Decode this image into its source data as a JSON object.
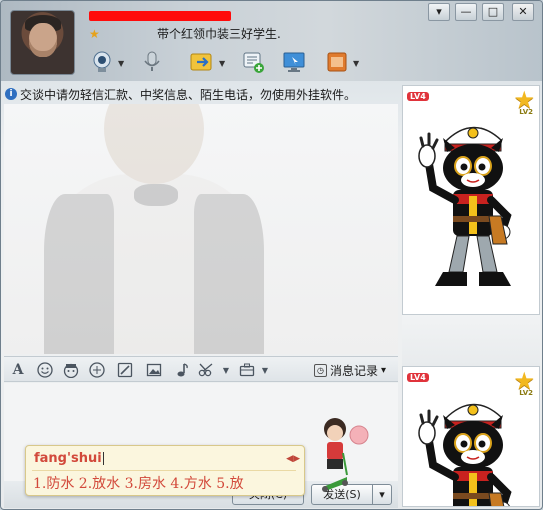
{
  "window": {
    "controls": {
      "menu": "▾",
      "minimize": "—",
      "maximize": "□",
      "close": "✕"
    }
  },
  "contact": {
    "signature": "带个红领巾装三好学生."
  },
  "notice": {
    "text": "交谈中请勿轻信汇款、中奖信息、陌生电话，勿使用外挂软件。"
  },
  "format_bar": {
    "history_label": "消息记录",
    "history_arrow": "▾"
  },
  "ime": {
    "pinyin": "fang'shui",
    "candidates": "1.防水  2.放水  3.房水  4.方水  5.放",
    "nav": "◀▶"
  },
  "bottom_bar": {
    "close_label": "关闭(C)",
    "send_label": "发送(S)",
    "send_arrow": "▾"
  },
  "side_panels": {
    "badge": "LV4",
    "star_label": "LV2"
  },
  "colors": {
    "redaction": "#ff0b0b",
    "ime_text": "#d2493b",
    "accent_blue": "#2f6fc0"
  },
  "icons": [
    "video-camera-icon",
    "microphone-icon",
    "file-transfer-icon",
    "message-icon",
    "remote-desktop-icon",
    "app-box-icon"
  ]
}
